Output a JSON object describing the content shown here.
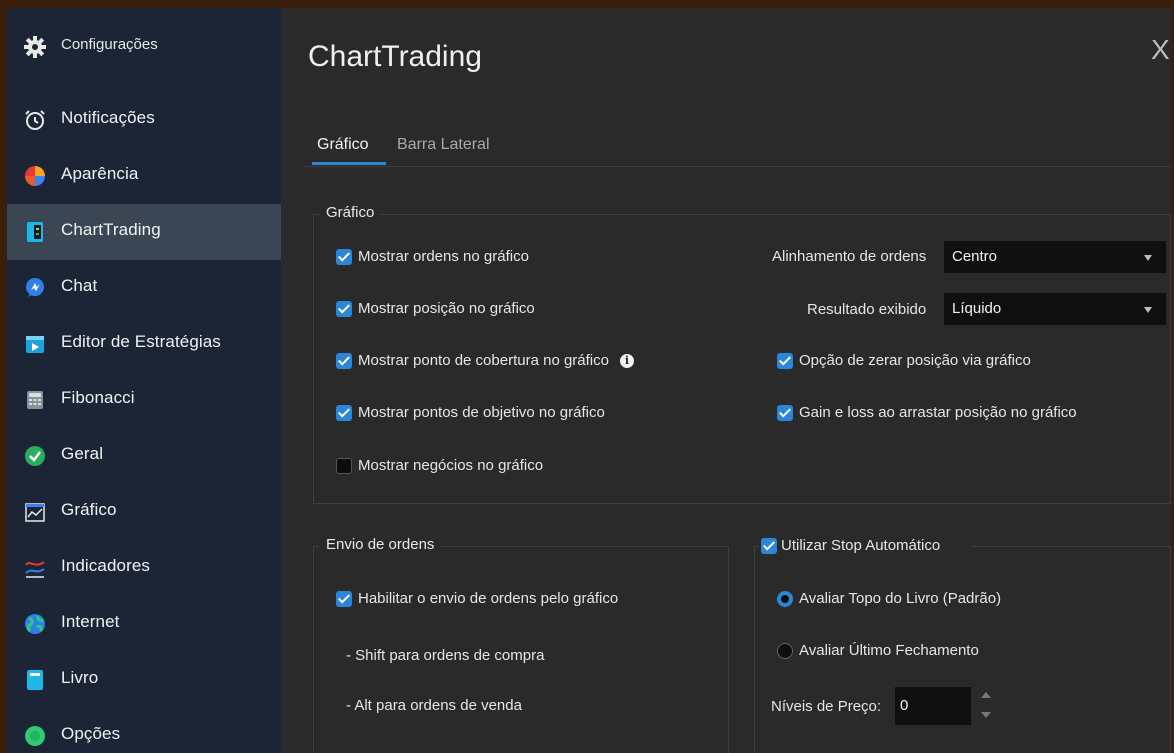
{
  "sidebar": {
    "header": {
      "label": "Configurações",
      "icon": "gear-icon"
    },
    "items": [
      {
        "label": "Notificações",
        "icon": "alarm-clock-icon"
      },
      {
        "label": "Aparência",
        "icon": "color-wheel-icon"
      },
      {
        "label": "ChartTrading",
        "icon": "charttrading-icon",
        "active": true
      },
      {
        "label": "Chat",
        "icon": "chat-icon"
      },
      {
        "label": "Editor de Estratégias",
        "icon": "play-editor-icon"
      },
      {
        "label": "Fibonacci",
        "icon": "calculator-icon"
      },
      {
        "label": "Geral",
        "icon": "check-circle-icon"
      },
      {
        "label": "Gráfico",
        "icon": "chart-icon"
      },
      {
        "label": "Indicadores",
        "icon": "indicators-icon"
      },
      {
        "label": "Internet",
        "icon": "globe-icon"
      },
      {
        "label": "Livro",
        "icon": "book-icon"
      },
      {
        "label": "Opções",
        "icon": "options-icon"
      }
    ]
  },
  "main": {
    "title": "ChartTrading",
    "close": "X",
    "tabs": [
      {
        "label": "Gráfico",
        "active": true
      },
      {
        "label": "Barra Lateral",
        "active": false
      }
    ]
  },
  "grafico_group": {
    "legend": "Gráfico",
    "left_options": [
      {
        "label": "Mostrar ordens no gráfico",
        "checked": true
      },
      {
        "label": "Mostrar posição no gráfico",
        "checked": true
      },
      {
        "label": "Mostrar ponto de cobertura no gráfico",
        "checked": true
      },
      {
        "label": "Mostrar pontos de objetivo no gráfico",
        "checked": true
      },
      {
        "label": "Mostrar negócios no gráfico",
        "checked": false
      }
    ],
    "alinhamento": {
      "label": "Alinhamento de ordens",
      "value": "Centro"
    },
    "resultado": {
      "label": "Resultado exibido",
      "value": "Líquido"
    },
    "right_options": [
      {
        "label": "Opção de zerar posição via gráfico",
        "checked": true
      },
      {
        "label": "Gain e loss ao arrastar posição no gráfico",
        "checked": true
      }
    ]
  },
  "envio_group": {
    "legend": "Envio de ordens",
    "enable": {
      "label": "Habilitar o envio de ordens pelo gráfico",
      "checked": true
    },
    "hint1": "- Shift para ordens de compra",
    "hint2": "- Alt para ordens de venda"
  },
  "stop_group": {
    "legend": "Utilizar Stop Automático",
    "checked": true,
    "radios": [
      {
        "label": "Avaliar Topo do Livro (Padrão)",
        "selected": true
      },
      {
        "label": "Avaliar Último Fechamento",
        "selected": false
      }
    ],
    "niveis": {
      "label": "Níveis de Preço:",
      "value": "0"
    }
  },
  "colors": {
    "accent": "#2a86d9",
    "sidebar_bg": "#1b2536",
    "main_bg": "#2a2a2b"
  }
}
